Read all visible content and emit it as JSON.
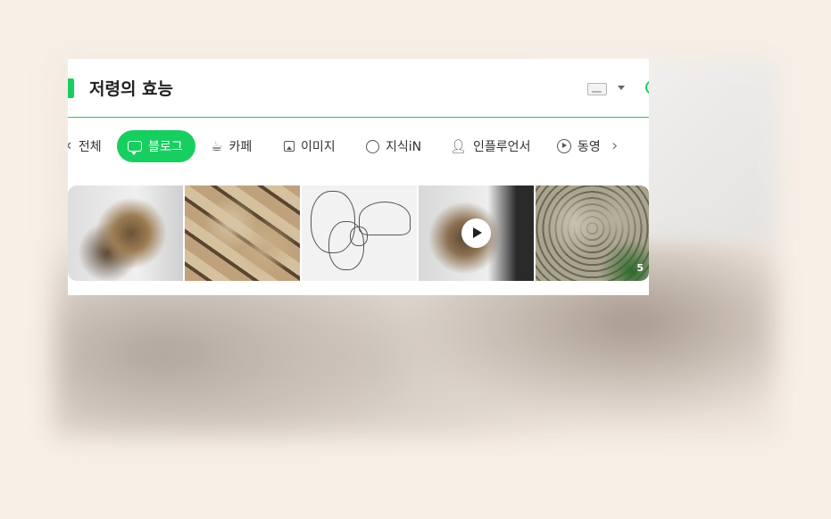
{
  "card": {
    "title": "저령의 효능"
  },
  "tabs": [
    {
      "label": "전체",
      "icon": "close-icon",
      "active": false
    },
    {
      "label": "블로그",
      "icon": "blog-icon",
      "active": true
    },
    {
      "label": "카페",
      "icon": "cafe-cup-icon",
      "active": false
    },
    {
      "label": "이미지",
      "icon": "image-icon",
      "active": false
    },
    {
      "label": "지식iN",
      "icon": "question-bubble-icon",
      "active": false
    },
    {
      "label": "인플루언서",
      "icon": "person-icon",
      "active": false
    },
    {
      "label": "동영",
      "icon": "video-play-icon",
      "active": false
    }
  ],
  "thumbnails": [
    {
      "alt": "dried polypore mushroom cluster"
    },
    {
      "alt": "sliced dried mushroom"
    },
    {
      "alt": "mushroom illustration sketch"
    },
    {
      "alt": "dried mushroom video",
      "video": true
    },
    {
      "alt": "maitake-like mushroom in forest",
      "count": "5"
    }
  ],
  "colors": {
    "accent": "#19ce60",
    "background": "#f8efe6"
  }
}
